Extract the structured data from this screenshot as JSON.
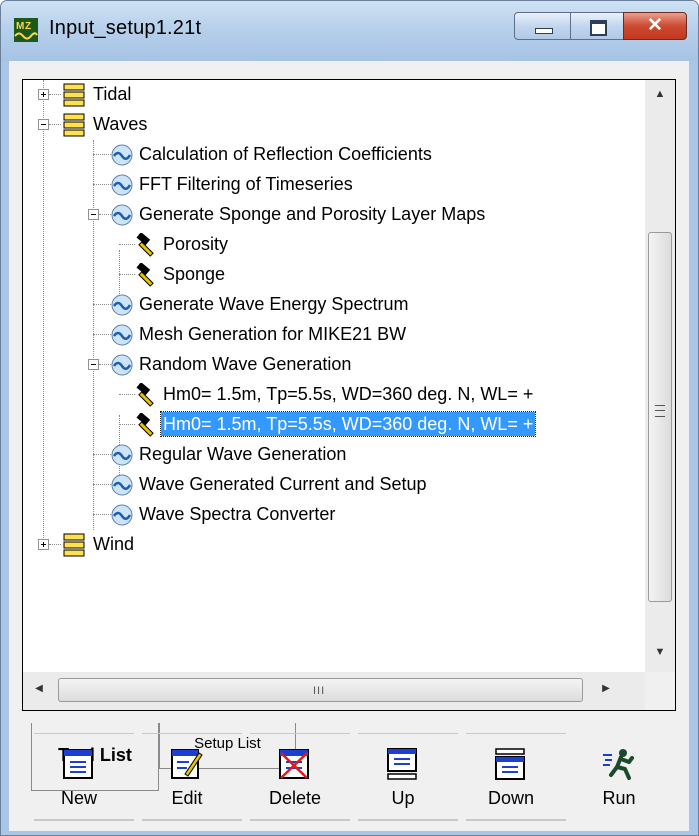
{
  "window": {
    "title": "Input_setup1.21t",
    "icon": "mike-zero-app-icon",
    "controls": [
      "minimize-icon",
      "maximize-icon",
      "close-icon"
    ],
    "close_glyph": "✕"
  },
  "tree": {
    "items": [
      {
        "label": "Tidal",
        "icon": "folder-stack-icon",
        "expander": "+"
      },
      {
        "label": "Waves",
        "icon": "folder-stack-icon",
        "expander": "−"
      },
      {
        "label": "Calculation of Reflection Coefficients",
        "icon": "wave-tool-icon"
      },
      {
        "label": "FFT Filtering of Timeseries",
        "icon": "wave-tool-icon"
      },
      {
        "label": "Generate Sponge and Porosity Layer Maps",
        "icon": "wave-tool-icon",
        "expander": "−"
      },
      {
        "label": "Porosity",
        "icon": "hammer-icon"
      },
      {
        "label": "Sponge",
        "icon": "hammer-icon"
      },
      {
        "label": "Generate Wave Energy Spectrum",
        "icon": "wave-tool-icon"
      },
      {
        "label": "Mesh Generation for MIKE21 BW",
        "icon": "wave-tool-icon"
      },
      {
        "label": "Random Wave Generation",
        "icon": "wave-tool-icon",
        "expander": "−"
      },
      {
        "label": "Hm0= 1.5m, Tp=5.5s, WD=360 deg. N, WL= +",
        "icon": "hammer-icon"
      },
      {
        "label": "Hm0= 1.5m, Tp=5.5s, WD=360 deg. N, WL= +",
        "icon": "hammer-icon",
        "selected": true
      },
      {
        "label": "Regular Wave Generation",
        "icon": "wave-tool-icon"
      },
      {
        "label": "Wave Generated Current and Setup",
        "icon": "wave-tool-icon"
      },
      {
        "label": "Wave Spectra Converter",
        "icon": "wave-tool-icon"
      },
      {
        "label": "Wind",
        "icon": "folder-stack-icon",
        "expander": "+"
      }
    ],
    "scroll_arrows": {
      "up": "▲",
      "down": "▼",
      "left": "◀",
      "right": "▶"
    },
    "hscroll_grip": "III"
  },
  "tabs": [
    {
      "label": "Tool List",
      "active": true
    },
    {
      "label": "Setup List",
      "active": false
    }
  ],
  "toolbar": [
    {
      "label": "New",
      "icon": "new-document-icon"
    },
    {
      "label": "Edit",
      "icon": "edit-document-icon"
    },
    {
      "label": "Delete",
      "icon": "delete-document-icon"
    },
    {
      "label": "Up",
      "icon": "move-up-icon"
    },
    {
      "label": "Down",
      "icon": "move-down-icon"
    },
    {
      "label": "Run",
      "icon": "run-icon"
    }
  ],
  "colors": {
    "selection": "#3399ff",
    "titlebar": "#b7d0eb",
    "close_button": "#c2371f"
  }
}
